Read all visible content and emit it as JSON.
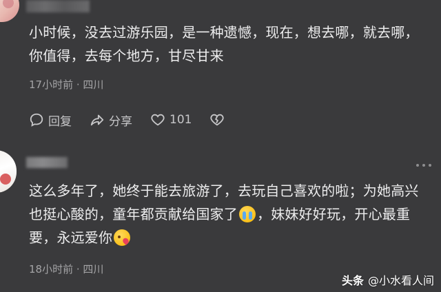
{
  "comments": [
    {
      "text": "小时候，没去过游乐园，是一种遗憾，现在，想去哪，就去哪，你值得，去每个地方，甘尽甘来",
      "time": "17小时前",
      "location": "四川",
      "actions": {
        "reply_label": "回复",
        "share_label": "分享",
        "like_count": "101"
      }
    },
    {
      "text_part1": "这么多年了，她终于能去旅游了，去玩自己喜欢的啦；为她高兴也挺心酸的，童年都贡献给国家了",
      "text_part2": "，妹妹好好玩，开心最重要，永远爱你",
      "time": "18小时前",
      "location": "四川"
    }
  ],
  "icons": {
    "reply": "comment-bubble-icon",
    "share": "share-arrow-icon",
    "like": "heart-icon",
    "dislike": "broken-heart-icon",
    "more": "more-dots-icon",
    "emoji1": "crying-face-emoji",
    "emoji2": "kissing-face-emoji"
  },
  "watermark": {
    "brand": "头条",
    "handle": "@小水看人间"
  },
  "colors": {
    "background": "#3a3a3c",
    "text": "#ededee",
    "meta": "#a4a4a6"
  }
}
